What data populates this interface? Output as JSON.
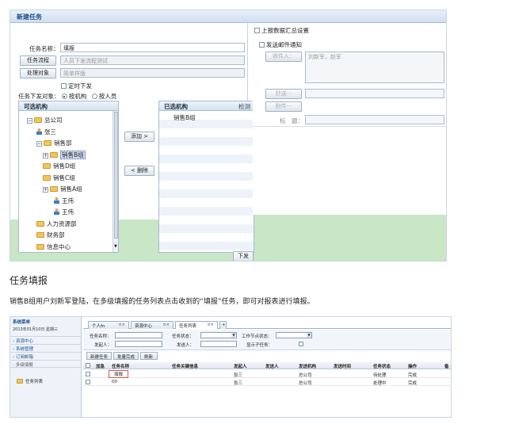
{
  "dialog": {
    "title": "新建任务",
    "task_name_label": "任务名称：",
    "task_name_value": "填报",
    "task_flow_button": "任务流程",
    "task_flow_value": "人员下发流程测试",
    "handle_object_button": "处理对象",
    "handle_object_value": "简单样版",
    "schedule_label": "定时下发",
    "dispatch_target_label": "任务下发对象：",
    "by_org_label": "按机构",
    "by_person_label": "按人员",
    "upload_summary_label": "上报数据汇总设置",
    "send_email_label": "发送邮件通知",
    "recipient_button": "收件人：",
    "recipient_value": "刘新军，赵军",
    "cc_button": "抄送···",
    "attachment_button": "附件···",
    "subject_label": "标　题：",
    "add_button": "添加 >",
    "delete_button": "< 删除",
    "dispatch_button": "下发"
  },
  "available_panel": {
    "header": "可选机构",
    "tree": [
      {
        "label": "总公司",
        "kind": "folder",
        "toggle": "−",
        "level": 0
      },
      {
        "label": "张三",
        "kind": "person",
        "toggle": "",
        "level": 1
      },
      {
        "label": "销售部",
        "kind": "folder",
        "toggle": "−",
        "level": 1
      },
      {
        "label": "销售B组",
        "kind": "folder",
        "toggle": "+",
        "level": 2,
        "selected": true
      },
      {
        "label": "销售D组",
        "kind": "folder",
        "toggle": "",
        "level": 2
      },
      {
        "label": "销售C组",
        "kind": "folder",
        "toggle": "",
        "level": 2
      },
      {
        "label": "销售A组",
        "kind": "folder",
        "toggle": "+",
        "level": 2
      },
      {
        "label": "王伟",
        "kind": "person",
        "toggle": "",
        "level": 3
      },
      {
        "label": "王伟",
        "kind": "person",
        "toggle": "",
        "level": 3
      },
      {
        "label": "人力资源部",
        "kind": "folder",
        "toggle": "",
        "level": 1
      },
      {
        "label": "财务部",
        "kind": "folder",
        "toggle": "",
        "level": 1
      },
      {
        "label": "信息中心",
        "kind": "folder",
        "toggle": "",
        "level": 1
      }
    ]
  },
  "selected_panel": {
    "header": "已选机构",
    "header_right": "检测",
    "items": [
      "销售B组"
    ]
  },
  "section_heading": "任务填报",
  "paragraph": "销售B组用户刘新军登陆，在多级填报的任务列表点击收到的“填报”任务，即可对报表进行填报。",
  "list_screen": {
    "sidebar_title": "系统菜单",
    "date_text": "2013年01月10日 星期三",
    "menu": [
      "资源中心",
      "系统管理",
      "订阅邮箱",
      "多级填报"
    ],
    "task_list_item": "任务列表",
    "tabs": [
      "个人fn",
      "资源中心",
      "任务列表"
    ],
    "filter": {
      "task_name": "任务名称：",
      "task_status": "任务状态：",
      "node_status": "工作节点状态：",
      "initiator": "发起人：",
      "sender": "发送人：",
      "show_subtasks": "显示子任务："
    },
    "toolbar": [
      "新建任务",
      "批量完成",
      "刷新"
    ],
    "columns": [
      "加急",
      "任务名称",
      "任务关键信息",
      "发起人",
      "发送人",
      "发送机构",
      "发送时间",
      "任务状态",
      "操作",
      "备"
    ],
    "rows": [
      [
        "",
        "填报",
        "",
        "张三",
        "",
        "总公司",
        "",
        "待处理",
        "完成",
        ""
      ],
      [
        "",
        "00",
        "",
        "张三",
        "",
        "总公司",
        "",
        "处理中",
        "完成",
        ""
      ]
    ]
  },
  "colors": {
    "accent": "#1e4f8a",
    "green_bg": "#c9e6c6",
    "highlight": "#d9534f"
  }
}
